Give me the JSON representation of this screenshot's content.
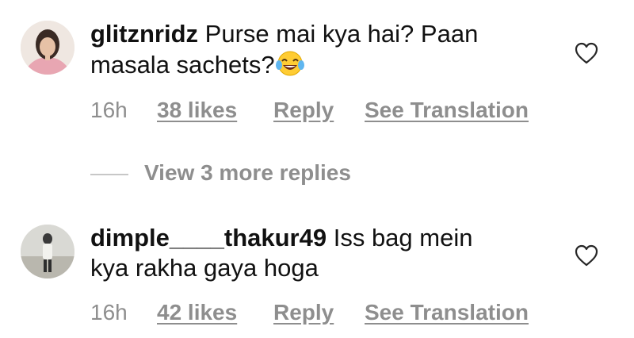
{
  "comments": [
    {
      "username": "glitznridz",
      "text_line1": "Purse mai kya hai? Paan",
      "text_line2": "masala sachets?",
      "emoji": "laughing-tears-emoji",
      "time": "16h",
      "likes": "38 likes",
      "reply": "Reply",
      "translate": "See Translation",
      "like_icon": "heart-outline-icon"
    },
    {
      "username": "dimple____thakur49",
      "text_line1": "Iss bag mein",
      "text_line2": "kya rakha gaya hoga",
      "time": "16h",
      "likes": "42 likes",
      "reply": "Reply",
      "translate": "See Translation",
      "like_icon": "heart-outline-icon"
    }
  ],
  "view_more": "View 3 more replies",
  "colors": {
    "text": "#111111",
    "muted": "#8e8e8e",
    "divider": "#c7c7c7"
  }
}
